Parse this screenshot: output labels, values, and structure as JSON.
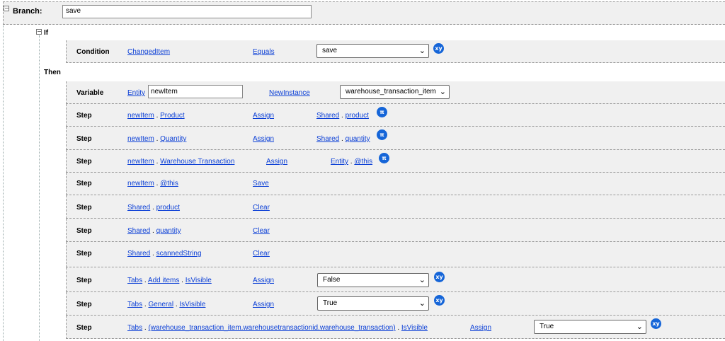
{
  "branch": {
    "label": "Branch:",
    "value": "save"
  },
  "if_block": {
    "label": "If",
    "condition": {
      "keyword": "Condition",
      "field": "ChangedItem",
      "operator": "Equals",
      "value": "save",
      "badge": "xy"
    }
  },
  "then_label": "Then",
  "variable": {
    "keyword": "Variable",
    "scope": "Entity",
    "name": "newItem",
    "action": "NewInstance",
    "type": "warehouse_transaction_item"
  },
  "steps": [
    {
      "keyword": "Step",
      "target": [
        "newItem",
        "Product"
      ],
      "action": "Assign",
      "source": [
        "Shared",
        "product"
      ],
      "badge": "π"
    },
    {
      "keyword": "Step",
      "target": [
        "newItem",
        "Quantity"
      ],
      "action": "Assign",
      "source": [
        "Shared",
        "quantity"
      ],
      "badge": "π"
    },
    {
      "keyword": "Step",
      "target": [
        "newItem",
        "Warehouse Transaction"
      ],
      "action": "Assign",
      "source": [
        "Entity",
        "@this"
      ],
      "badge": "π"
    },
    {
      "keyword": "Step",
      "target": [
        "newItem",
        "@this"
      ],
      "action": "Save"
    },
    {
      "keyword": "Step",
      "target": [
        "Shared",
        "product"
      ],
      "action": "Clear"
    },
    {
      "keyword": "Step",
      "target": [
        "Shared",
        "quantity"
      ],
      "action": "Clear"
    },
    {
      "keyword": "Step",
      "target": [
        "Shared",
        "scannedString"
      ],
      "action": "Clear"
    },
    {
      "keyword": "Step",
      "target": [
        "Tabs",
        "Add items",
        "IsVisible"
      ],
      "action": "Assign",
      "select": "False",
      "badge": "xy"
    },
    {
      "keyword": "Step",
      "target": [
        "Tabs",
        "General",
        "IsVisible"
      ],
      "action": "Assign",
      "select": "True",
      "badge": "xy"
    },
    {
      "keyword": "Step",
      "target": [
        "Tabs",
        "(warehouse_transaction_item.warehousetransactionid.warehouse_transaction)",
        "IsVisible"
      ],
      "action": "Assign",
      "select": "True",
      "badge": "xy"
    }
  ],
  "separator": ".",
  "icons": {
    "collapse": "minus-box-icon",
    "dropdown": "chevron-down-icon",
    "variable_badge": "xy-icon",
    "expression_badge": "pi-icon"
  },
  "colors": {
    "link": "#0b3fd6",
    "badge": "#1565d8",
    "row_bg": "#f0f0f0"
  }
}
